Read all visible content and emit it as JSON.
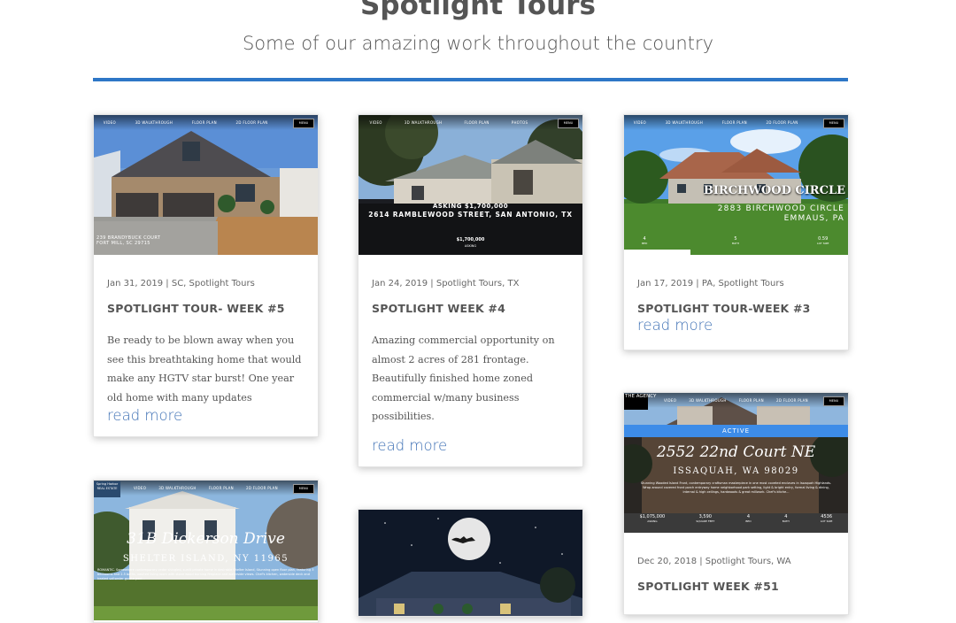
{
  "header": {
    "title": "Spotlight Tours",
    "subtitle": "Some of our amazing work throughout the country"
  },
  "tour_nav": [
    "VIDEO",
    "3D WALKTHROUGH",
    "FLOOR PLAN",
    "2D FLOOR PLAN",
    "PHOTOS"
  ],
  "menu_label": "MENU",
  "cards": [
    {
      "date_cats": "Jan 31, 2019 | SC, Spotlight Tours",
      "title": "SPOTLIGHT TOUR- WEEK #5",
      "excerpt": "Be ready to be blown away when you see this breathtaking home that would make any HGTV star burst! One year old home with many updates",
      "read_more": "read more",
      "thumb": {
        "address_line1": "239 BRANDYBUCK COURT",
        "address_line2": "FORT MILL, SC 29715"
      }
    },
    {
      "date_cats": "Jan 24, 2019 | Spotlight Tours, TX",
      "title": "SPOTLIGHT WEEK #4",
      "excerpt": "Amazing commercial opportunity on almost 2 acres of 281 frontage. Beautifully finished home zoned commercial w/many business possibilities.",
      "read_more": "read more",
      "thumb": {
        "asking": "ASKING $1,700,000",
        "address": "2614 RAMBLEWOOD STREET, SAN ANTONIO, TX",
        "price": "$1,700,000",
        "price_label": "ASKING"
      }
    },
    {
      "date_cats": "Jan 17, 2019 | PA, Spotlight Tours",
      "title": "SPOTLIGHT TOUR-WEEK #3",
      "read_more": "read more",
      "thumb": {
        "street_name": "BIRCHWOOD CIRCLE",
        "address_line1": "2883 BIRCHWOOD CIRCLE",
        "address_line2": "EMMAUS, PA",
        "stats": [
          {
            "value": "4",
            "label": "BED"
          },
          {
            "value": "5",
            "label": "BATH"
          },
          {
            "value": "0.59",
            "label": "LOT SIZE"
          }
        ]
      }
    },
    {
      "date_cats": "Dec 20, 2018 | Spotlight Tours, WA",
      "title": "SPOTLIGHT WEEK #51",
      "thumb": {
        "brand": "THE AGENCY",
        "status": "ACTIVE",
        "address_line1": "2552 22nd Court NE",
        "address_line2": "ISSAQUAH, WA 98029",
        "desc": "Stunning Wooded Island Front, contemporary craftsman masterpiece in one most coveted enclaves in Issaquah Highlands. Wrap around covered front porch entryway home neighborhood park setting, light & bright entry, formal living & dining, internal & high ceilings, hardwoods & great millwork. Chef's kitche...",
        "stats": [
          {
            "value": "$1,075,000",
            "label": "ASKING"
          },
          {
            "value": "3,590",
            "label": "SQUARE FEET"
          },
          {
            "value": "4",
            "label": "BED"
          },
          {
            "value": "4",
            "label": "BATH"
          },
          {
            "value": "4536",
            "label": "LOT SIZE"
          }
        ]
      }
    },
    {
      "thumb": {
        "brand": "Spring Harbor REAL ESTATE",
        "address_line1": "31B Dickerson Drive",
        "address_line2": "SHELTER ISLAND, NY 11965",
        "desc": "ROMANTIC. Somewhere contemporary cedar shingled, sunlit private home in desirable Shelter Island, Stunning open floor plan, featuring 3 bedrooms and 2.5 baths, vaulted living room with stone wood burning fireplace and waterside views. Chef's kitchen, waterside deck and heated saltwater gunite pool..."
      }
    },
    {
      "thumb": {}
    }
  ]
}
